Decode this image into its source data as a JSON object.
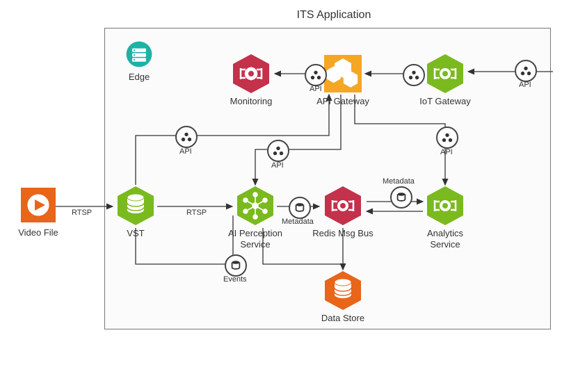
{
  "diagram": {
    "title": "ITS Application",
    "nodes": {
      "video_file": {
        "label": "Video File"
      },
      "edge": {
        "label": "Edge"
      },
      "monitoring": {
        "label": "Monitoring"
      },
      "api_gateway": {
        "label": "API Gateway"
      },
      "iot_gateway": {
        "label": "IoT Gateway"
      },
      "vst": {
        "label": "VST"
      },
      "ai_perception": {
        "label": "AI Perception Service"
      },
      "redis": {
        "label": "Redis Msg Bus"
      },
      "analytics": {
        "label": "Analytics Service"
      },
      "data_store": {
        "label": "Data Store"
      }
    },
    "edges": {
      "rtsp1": {
        "label": "RTSP"
      },
      "rtsp2": {
        "label": "RTSP"
      },
      "metadata1": {
        "label": "Metadata"
      },
      "metadata2": {
        "label": "Metadata"
      },
      "events": {
        "label": "Events"
      },
      "api1": {
        "label": "API"
      },
      "api2": {
        "label": "API"
      },
      "api3": {
        "label": "API"
      },
      "api4": {
        "label": "API"
      },
      "api5": {
        "label": "API"
      }
    },
    "colors": {
      "green": "#7aba1e",
      "red": "#c4314b",
      "yellow": "#f5a623",
      "orange": "#e8651a",
      "teal": "#1fb1a6"
    }
  }
}
